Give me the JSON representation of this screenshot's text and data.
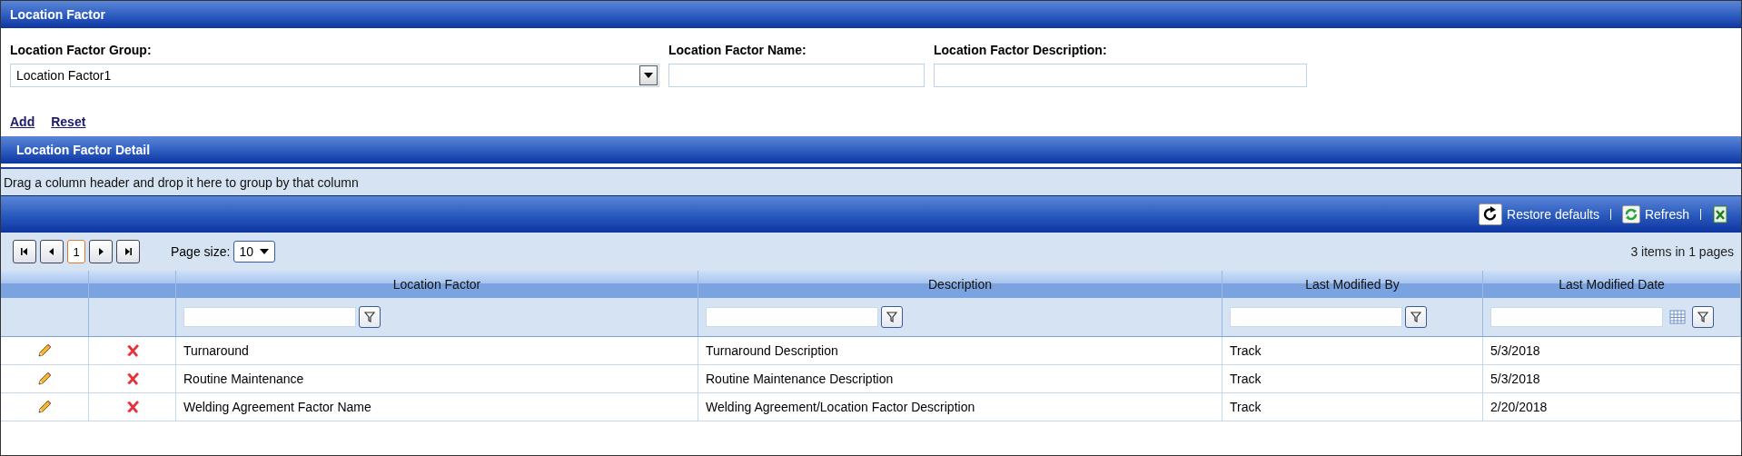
{
  "header": {
    "title": "Location Factor"
  },
  "form": {
    "fields": [
      {
        "label": "Location Factor Group:",
        "kind": "dropdown",
        "value": "Location Factor1"
      },
      {
        "label": "Location Factor Name:",
        "kind": "text"
      },
      {
        "label": "Location Factor Description:",
        "kind": "text"
      }
    ],
    "links": [
      "Add",
      "Reset"
    ]
  },
  "detail": {
    "title": "Location Factor Detail",
    "group_hint": "Drag a column header and drop it here to group by that column",
    "toolbar": [
      {
        "kind": "restore",
        "label": "Restore defaults"
      },
      {
        "kind": "refresh",
        "label": "Refresh"
      },
      {
        "kind": "export"
      }
    ],
    "pager": {
      "pages": [
        {
          "label": "1",
          "selected": true
        }
      ],
      "page_size_label": "Page size:",
      "page_size": "10",
      "summary": "3 items in 1 pages"
    },
    "columns": [
      {
        "kind": "edit"
      },
      {
        "kind": "delete"
      },
      {
        "kind": "data",
        "label": "Location Factor",
        "date_picker": false
      },
      {
        "kind": "data",
        "label": "Description",
        "date_picker": false
      },
      {
        "kind": "data",
        "label": "Last Modified By",
        "date_picker": false
      },
      {
        "kind": "data",
        "label": "Last Modified Date",
        "date_picker": true
      }
    ],
    "rows": [
      {
        "cells": [
          "Turnaround",
          "Turnaround Description",
          "Track",
          "5/3/2018"
        ]
      },
      {
        "cells": [
          "Routine Maintenance",
          "Routine Maintenance Description",
          "Track",
          "5/3/2018"
        ]
      },
      {
        "cells": [
          "Welding Agreement Factor Name",
          "Welding Agreement/Location Factor Description",
          "Track",
          "2/20/2018"
        ]
      }
    ]
  }
}
